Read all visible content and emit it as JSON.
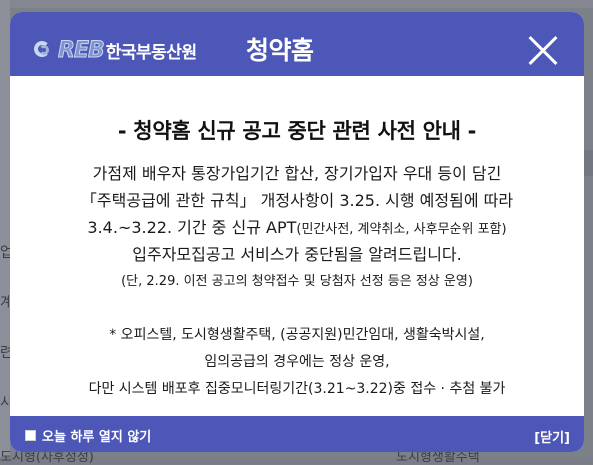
{
  "header": {
    "logo_text": "REB",
    "org_name": "한국부동산원",
    "brand_name": "청약홈"
  },
  "title": "- 청약홈 신규 공고 중단 관련 사전 안내 -",
  "body": {
    "line1": "가점제 배우자 통장가입기간 합산, 장기가입자 우대 등이 담긴",
    "line2": "「주택공급에 관한 규칙」 개정사항이 3.25. 시행 예정됨에 따라",
    "line3_main": "3.4.~3.22. 기간 중 신규 APT",
    "line3_paren": "(민간사전, 계약취소, 사후무순위 포함)",
    "line4": "입주자모집공고 서비스가 중단됨을 알려드립니다.",
    "line5": "(단, 2.29. 이전 공고의 청약접수 및 당첨자 선정 등은 정상 운영)"
  },
  "notes": {
    "line1": "* 오피스텔, 도시형생활주택, (공공지원)민간임대, 생활숙박시설,",
    "line2": "임의공급의 경우에는 정상 운영,",
    "line3": "다만 시스템 배포후 집중모니터링기간(3.21~3.22)중 접수 · 추첨 불가"
  },
  "footer": {
    "dont_show_today": "오늘 하루 열지 않기",
    "close_label": "[닫기]"
  },
  "background": {
    "left_fragments": [
      "업",
      "계",
      "련",
      "시"
    ],
    "bottom_left": "도시형(사후정정)",
    "bottom_right": "도시형생활주택"
  }
}
